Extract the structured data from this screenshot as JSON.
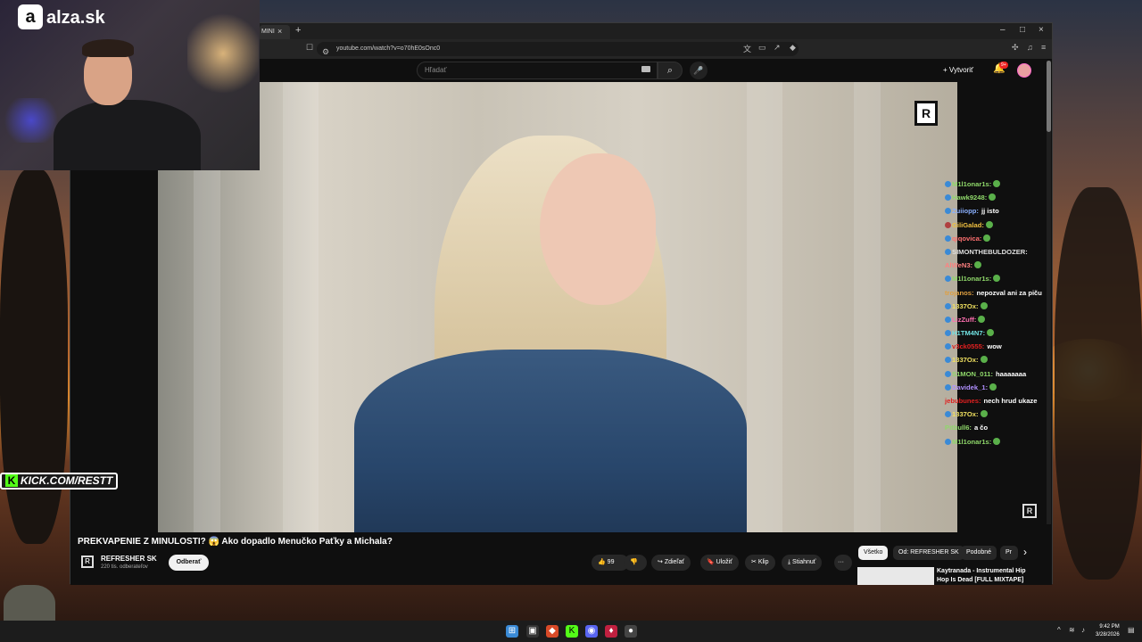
{
  "browser": {
    "tab_label": "MINI",
    "tab_close": "×",
    "new_tab": "+",
    "url": "youtube.com/watch?v=o70hE0sOnc0",
    "window_controls": [
      "–",
      "□",
      "×"
    ]
  },
  "youtube": {
    "search_placeholder": "Hľadať",
    "create_label": "Vytvoriť",
    "notifications_badge": "9+"
  },
  "video": {
    "title": "PREKVAPENIE Z MINULOSTI? 😱 Ako dopadlo Menučko Paťky a Michala?",
    "channel_name": "REFRESHER SK",
    "channel_subs": "220 tis. odberateľov",
    "subscribe_label": "Odberať",
    "likes": "99",
    "share_label": "Zdieľať",
    "save_label": "Uložiť",
    "clip_label": "Klip",
    "download_label": "Stiahnuť",
    "more_label": "···"
  },
  "sidebar": {
    "chips": [
      "Všetko",
      "Od: REFRESHER SK",
      "Podobné",
      "Pr"
    ],
    "next_arrow": "›",
    "rec_title": "Kaytranada - Instrumental Hip Hop Is Dead [FULL MIXTAPE]"
  },
  "chat": {
    "messages": [
      {
        "user": "M1l1onar1s:",
        "text": "",
        "color": "#8fd86a",
        "badge": "#3a8ad6",
        "emote": true
      },
      {
        "user": "Hawk9248:",
        "text": "",
        "color": "#8fd86a",
        "badge": "#3a8ad6",
        "emote": true
      },
      {
        "user": "Zuiiopp:",
        "text": "jj isto",
        "color": "#8ab0ff",
        "badge": "#3a8ad6",
        "emote": false
      },
      {
        "user": "GiliGalad:",
        "text": "",
        "color": "#f0c040",
        "badge": "#b04040",
        "emote": true
      },
      {
        "user": "qiqovica:",
        "text": "",
        "color": "#ff7070",
        "badge": "#3a8ad6",
        "emote": true
      },
      {
        "user": "SIMONTHEBULDOZER:",
        "text": "",
        "color": "#e0e0e0",
        "badge": "#3a8ad6",
        "emote": false
      },
      {
        "user": "AlWeN3:",
        "text": "",
        "color": "#ff8080",
        "badge": "",
        "emote": true
      },
      {
        "user": "M1l1onar1s:",
        "text": "",
        "color": "#8fd86a",
        "badge": "#3a8ad6",
        "emote": true
      },
      {
        "user": "trojanos:",
        "text": "nepozval ani za piču",
        "color": "#e0a040",
        "badge": "",
        "emote": false
      },
      {
        "user": "1337Ox:",
        "text": "",
        "color": "#f0e060",
        "badge": "#3a8ad6",
        "emote": true
      },
      {
        "user": "LizZuff:",
        "text": "",
        "color": "#ff70b0",
        "badge": "#3a8ad6",
        "emote": true
      },
      {
        "user": "H1TM4N7:",
        "text": "",
        "color": "#70e0e0",
        "badge": "#3a8ad6",
        "emote": true
      },
      {
        "user": "v3ck0555:",
        "text": "wow",
        "color": "#e02020",
        "badge": "#3a8ad6",
        "emote": false
      },
      {
        "user": "1337Ox:",
        "text": "",
        "color": "#f0e060",
        "badge": "#3a8ad6",
        "emote": true
      },
      {
        "user": "S1MON_011:",
        "text": "haaaaaaa",
        "color": "#8fd86a",
        "badge": "#3a8ad6",
        "emote": false
      },
      {
        "user": "Davidek_1:",
        "text": "",
        "color": "#b090ff",
        "badge": "#3a8ad6",
        "emote": true
      },
      {
        "user": "jebubunes:",
        "text": "nech hrud ukaze",
        "color": "#e02020",
        "badge": "",
        "emote": false
      },
      {
        "user": "1337Ox:",
        "text": "",
        "color": "#f0e060",
        "badge": "#3a8ad6",
        "emote": true
      },
      {
        "user": "Pitbull6:",
        "text": "a čo",
        "color": "#8fd86a",
        "badge": "",
        "emote": false
      },
      {
        "user": "M1l1onar1s:",
        "text": "",
        "color": "#8fd86a",
        "badge": "#3a8ad6",
        "emote": true
      }
    ]
  },
  "overlay": {
    "alza_text": "alza.sk",
    "alza_mark": "a",
    "kick_text": "KICK.COM/RESTT",
    "kick_mark": "K"
  },
  "taskbar": {
    "time": "9:42 PM",
    "date": "3/28/2026"
  }
}
